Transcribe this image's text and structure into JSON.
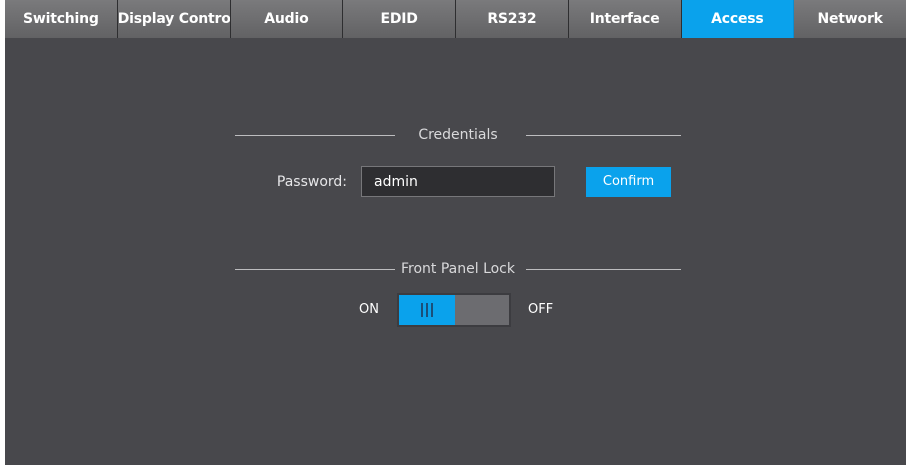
{
  "tabs": [
    {
      "label": "Switching",
      "active": false
    },
    {
      "label": "Display Control",
      "active": false
    },
    {
      "label": "Audio",
      "active": false
    },
    {
      "label": "EDID",
      "active": false
    },
    {
      "label": "RS232",
      "active": false
    },
    {
      "label": "Interface",
      "active": false
    },
    {
      "label": "Access",
      "active": true
    },
    {
      "label": "Network",
      "active": false
    }
  ],
  "credentials": {
    "title": "Credentials",
    "password_label": "Password:",
    "password_value": "admin",
    "confirm_label": "Confirm"
  },
  "front_panel_lock": {
    "title": "Front Panel Lock",
    "on_label": "ON",
    "off_label": "OFF",
    "state": "on",
    "knob_icon": "grip-lines-icon"
  },
  "colors": {
    "accent": "#0aa2ec",
    "background": "#48484c",
    "tab_bg": "#6e6e70"
  }
}
